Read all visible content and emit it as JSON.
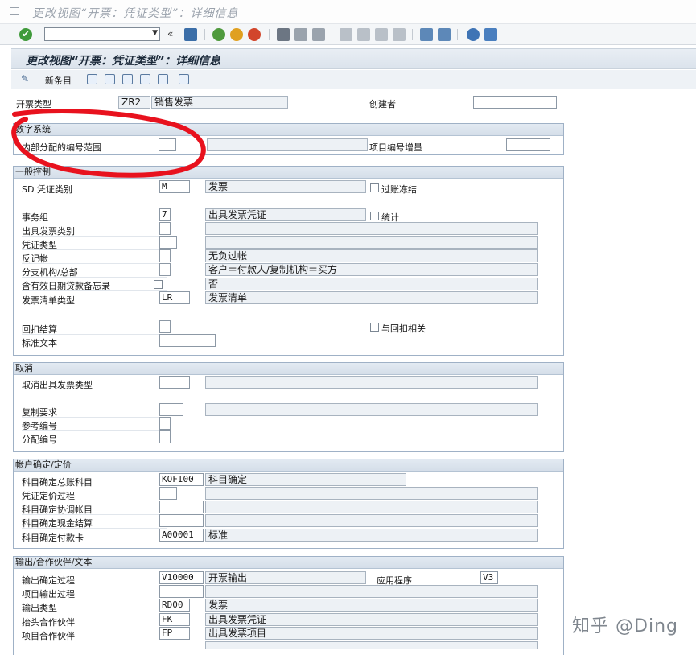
{
  "window": {
    "title": "更改视图“开票：凭证类型”：详细信息"
  },
  "screen": {
    "title": "更改视图“开票：凭证类型”：详细信息"
  },
  "toolbar": {
    "new_entries": "新条目"
  },
  "header": {
    "billing_type_label": "开票类型",
    "billing_type_value": "ZR2",
    "billing_type_desc": "销售发票",
    "created_by_label": "创建者",
    "created_by_value": ""
  },
  "number_system": {
    "title": "数字系统",
    "internal_range_label": "内部分配的编号范围",
    "item_increment_label": "项目编号增量"
  },
  "general_control": {
    "title": "一般控制",
    "sd_doc_cat_label": "SD 凭证类别",
    "sd_doc_cat_value": "M",
    "sd_doc_cat_desc": "发票",
    "posting_block_label": "过账冻结",
    "txn_group_label": "事务组",
    "txn_group_value": "7",
    "txn_group_desc": "出具发票凭证",
    "statistics_label": "统计",
    "billing_category_label": "出具发票类别",
    "doc_type_label": "凭证类型",
    "neg_posting_label": "反记帐",
    "neg_posting_desc": "无负过帐",
    "branch_head_label": "分支机构/总部",
    "branch_head_desc": "客户＝付款人/复制机构＝买方",
    "valid_date_label": "含有效日期贷款备忘录",
    "valid_date_desc": "否",
    "invoice_list_label": "发票清单类型",
    "invoice_list_value": "LR",
    "invoice_list_desc": "发票清单",
    "rebate_label": "回扣结算",
    "rebate_relevant_label": "与回扣相关",
    "std_text_label": "标准文本"
  },
  "cancellation": {
    "title": "取消",
    "cancel_type_label": "取消出具发票类型",
    "copy_req_label": "复制要求",
    "ref_number_label": "参考编号",
    "alloc_number_label": "分配编号"
  },
  "account_pricing": {
    "title": "帐户确定/定价",
    "acct_proc_label": "科目确定总账科目",
    "acct_proc_value": "KOFI00",
    "acct_proc_desc": "科目确定",
    "pricing_proc_label": "凭证定价过程",
    "reconc_label": "科目确定协调帐目",
    "cash_label": "科目确定现金结算",
    "payment_card_label": "科目确定付款卡",
    "payment_card_value": "A00001",
    "payment_card_desc": "标准"
  },
  "output": {
    "title": "输出/合作伙伴/文本",
    "output_proc_label": "输出确定过程",
    "output_proc_value": "V10000",
    "output_proc_desc": "开票输出",
    "application_label": "应用程序",
    "application_value": "V3",
    "item_output_label": "项目输出过程",
    "output_type_label": "输出类型",
    "output_type_value": "RD00",
    "output_type_desc": "发票",
    "header_partner_label": "抬头合作伙伴",
    "header_partner_value": "FK",
    "header_partner_desc": "出具发票凭证",
    "item_partner_label": "项目合作伙伴",
    "item_partner_value": "FP",
    "item_partner_desc": "出具发票项目"
  },
  "watermark": "知乎 @Ding",
  "colors": {
    "annotation": "#e8121e",
    "group_border": "#9fb1c6",
    "header_bg": "#dbe3ec"
  }
}
